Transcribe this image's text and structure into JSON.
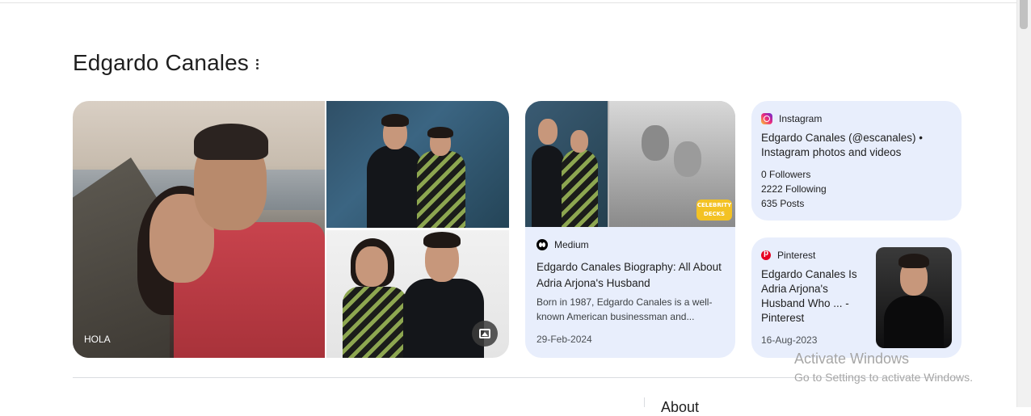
{
  "page": {
    "title": "Edgardo Canales"
  },
  "collage": {
    "caption": "HOLA"
  },
  "cards": {
    "medium": {
      "source": "Medium",
      "badge_line1": "CELEBRITY",
      "badge_line2": "DECKS",
      "title": "Edgardo Canales Biography: All About Adria Arjona's Husband",
      "description": "Born in 1987, Edgardo Canales is a well-known American businessman and...",
      "date": "29-Feb-2024"
    },
    "instagram": {
      "source": "Instagram",
      "title": "Edgardo Canales (@escanales) • Instagram photos and videos",
      "followers": "0 Followers",
      "following": "2222 Following",
      "posts": "635 Posts"
    },
    "pinterest": {
      "source": "Pinterest",
      "title": "Edgardo Canales Is Adria Arjona's Husband Who ... - Pinterest",
      "date": "16-Aug-2023"
    }
  },
  "section": {
    "about_label": "About"
  },
  "watermark": {
    "line1": "Activate Windows",
    "line2": "Go to Settings to activate Windows."
  }
}
